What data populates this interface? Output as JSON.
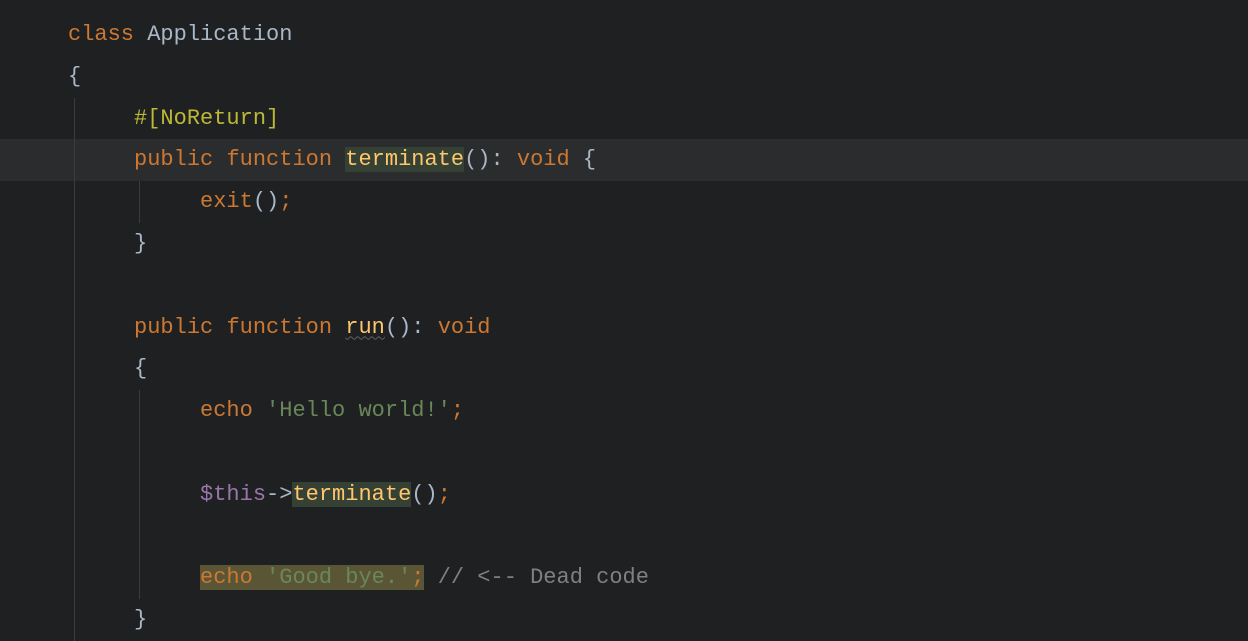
{
  "code": {
    "class_keyword": "class",
    "class_name": "Application",
    "open_brace": "{",
    "attribute": "#[NoReturn]",
    "public1": "public",
    "function1": "function",
    "terminate_name": "terminate",
    "terminate_parens": "()",
    "terminate_colon": ":",
    "terminate_type": "void",
    "terminate_open": "{",
    "exit_call": "exit",
    "exit_parens": "()",
    "exit_semi": ";",
    "terminate_close": "}",
    "public2": "public",
    "function2": "function",
    "run_name": "run",
    "run_parens": "()",
    "run_colon": ":",
    "run_type": "void",
    "run_open": "{",
    "echo1": "echo",
    "string1": "'Hello world!'",
    "semi1": ";",
    "this_var": "$this",
    "arrow": "->",
    "terminate_call": "terminate",
    "call_parens": "()",
    "call_semi": ";",
    "echo2": "echo",
    "string2": "'Good bye.'",
    "semi2": ";",
    "comment": "// <-- Dead code",
    "run_close": "}"
  }
}
